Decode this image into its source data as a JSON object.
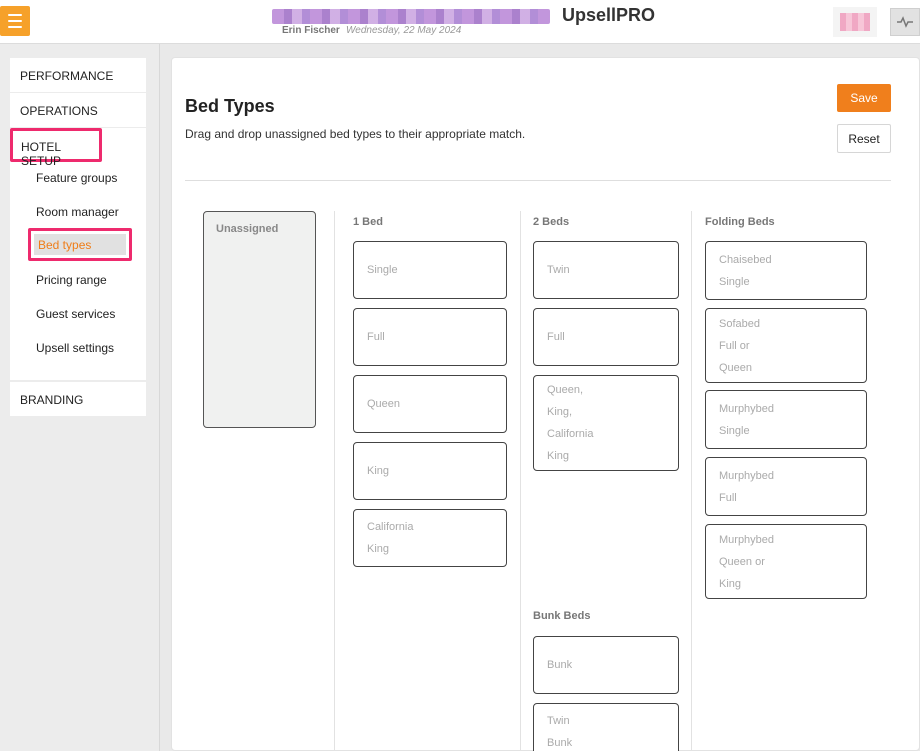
{
  "header": {
    "user": "Erin Fischer",
    "date": "Wednesday, 22 May 2024",
    "app_name": "UpsellPRO"
  },
  "sidebar": {
    "performance": "PERFORMANCE",
    "operations": "OPERATIONS",
    "hotel_setup": "HOTEL SETUP",
    "sub_items": [
      "Feature groups",
      "Room manager",
      "Bed types",
      "Pricing range",
      "Guest services",
      "Upsell settings"
    ],
    "branding": "BRANDING"
  },
  "main": {
    "title": "Bed Types",
    "description": "Drag and drop unassigned bed types to their appropriate match.",
    "save_label": "Save",
    "reset_label": "Reset",
    "unassigned_label": "Unassigned",
    "columns": {
      "one_bed": {
        "label": "1 Bed",
        "items": [
          [
            "Single"
          ],
          [
            "Full"
          ],
          [
            "Queen"
          ],
          [
            "King"
          ],
          [
            "California",
            "King"
          ]
        ]
      },
      "two_beds": {
        "label": "2 Beds",
        "items": [
          [
            "Twin"
          ],
          [
            "Full"
          ],
          [
            "Queen,",
            "King,",
            "California",
            "King"
          ]
        ]
      },
      "bunk_beds": {
        "label": "Bunk Beds",
        "items": [
          [
            "Bunk"
          ],
          [
            "Twin",
            "Bunk"
          ]
        ]
      },
      "folding_beds": {
        "label": "Folding Beds",
        "items": [
          [
            "Chaisebed",
            "Single"
          ],
          [
            "Sofabed",
            "Full or",
            "Queen"
          ],
          [
            "Murphybed",
            "Single"
          ],
          [
            "Murphybed",
            "Full"
          ],
          [
            "Murphybed",
            "Queen or",
            "King"
          ]
        ]
      }
    }
  },
  "colors": {
    "accent": "#f07f1c",
    "highlight": "#ee2a6d",
    "menu": "#f6a12a"
  },
  "icons": {
    "menu": "hamburger-icon",
    "activity": "activity-icon"
  }
}
